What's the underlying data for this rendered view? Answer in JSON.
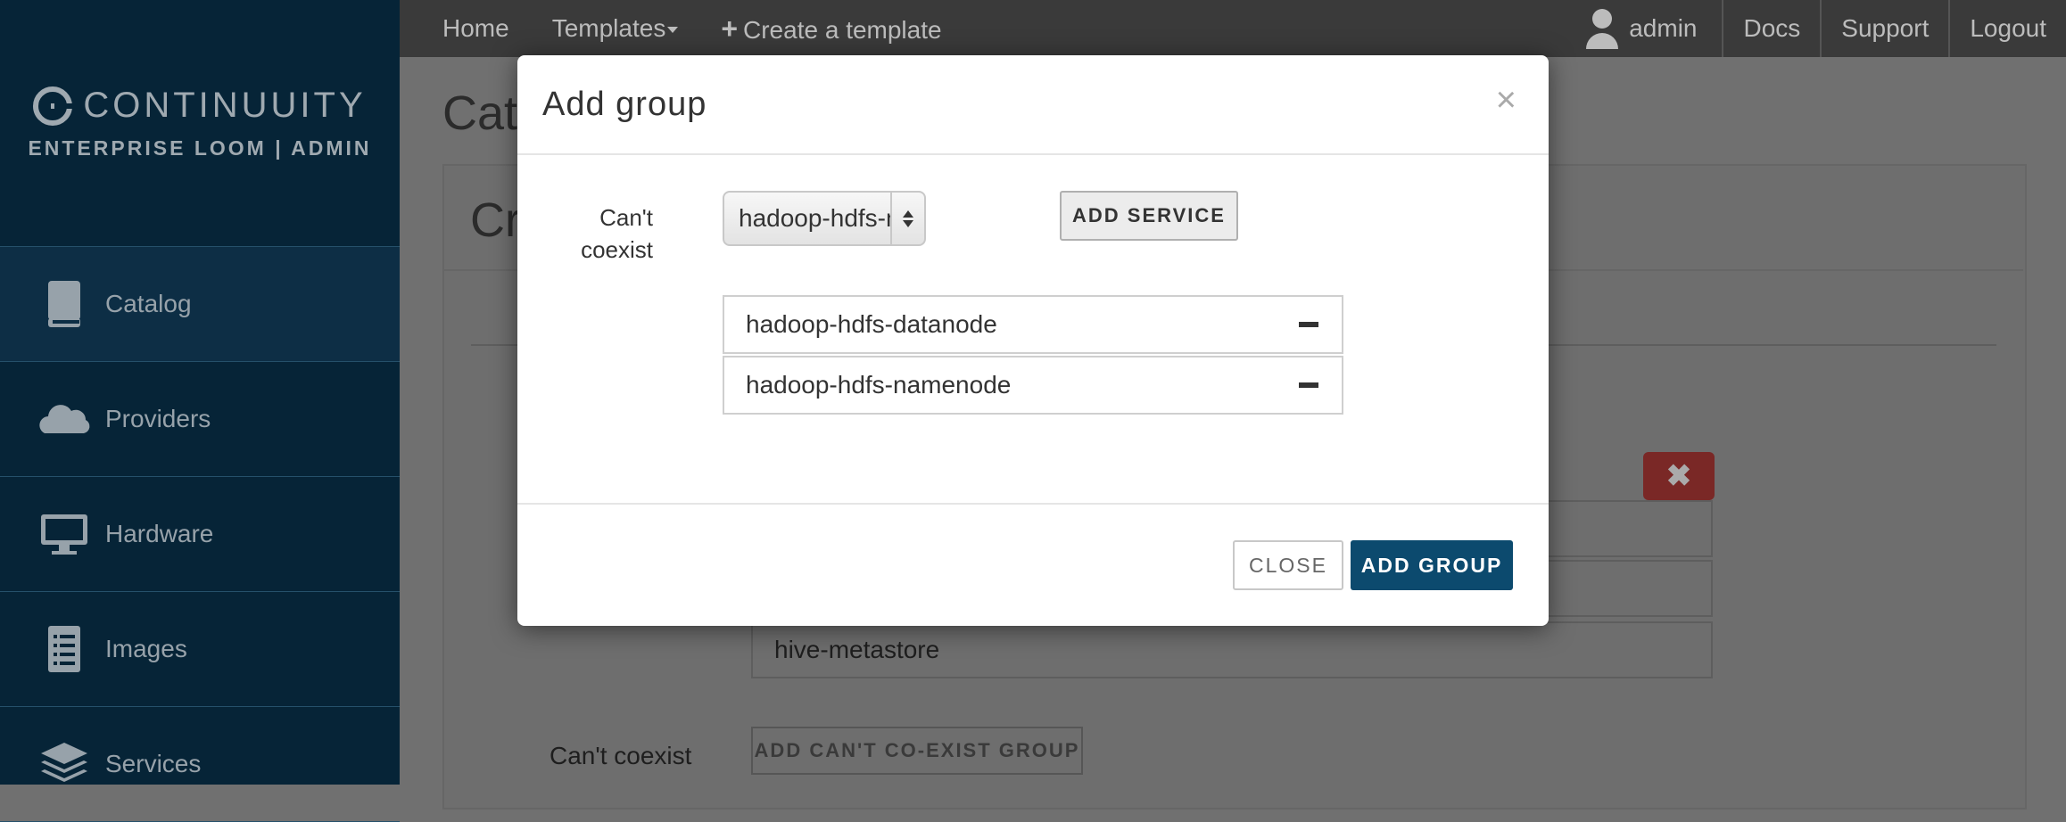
{
  "brand": {
    "name": "CONTINUUITY",
    "subtitle": "ENTERPRISE LOOM | ADMIN"
  },
  "sidebar": {
    "items": [
      {
        "label": "Catalog",
        "icon": "book-icon",
        "active": true
      },
      {
        "label": "Providers",
        "icon": "cloud-icon",
        "active": false
      },
      {
        "label": "Hardware",
        "icon": "monitor-icon",
        "active": false
      },
      {
        "label": "Images",
        "icon": "document-icon",
        "active": false
      },
      {
        "label": "Services",
        "icon": "layers-icon",
        "active": false
      }
    ]
  },
  "topbar": {
    "home": "Home",
    "templates": "Templates",
    "create": "Create a template",
    "user": "admin",
    "docs": "Docs",
    "support": "Support",
    "logout": "Logout"
  },
  "page": {
    "title": "Cata",
    "panel_title": "Cr",
    "services": [
      "hive-metastore"
    ],
    "cant_coexist_label": "Can't coexist",
    "add_cant_coexist_button": "ADD CAN'T CO-EXIST GROUP"
  },
  "modal": {
    "title": "Add group",
    "field_label": "Can't coexist",
    "select_value": "hadoop-hdfs-namenode",
    "add_service_button": "ADD SERVICE",
    "services": [
      "hadoop-hdfs-datanode",
      "hadoop-hdfs-namenode"
    ],
    "close_button": "CLOSE",
    "add_group_button": "ADD GROUP"
  },
  "colors": {
    "sidebar_bg": "#062437",
    "primary_button": "#0c4a6e",
    "danger": "#c9302c"
  }
}
